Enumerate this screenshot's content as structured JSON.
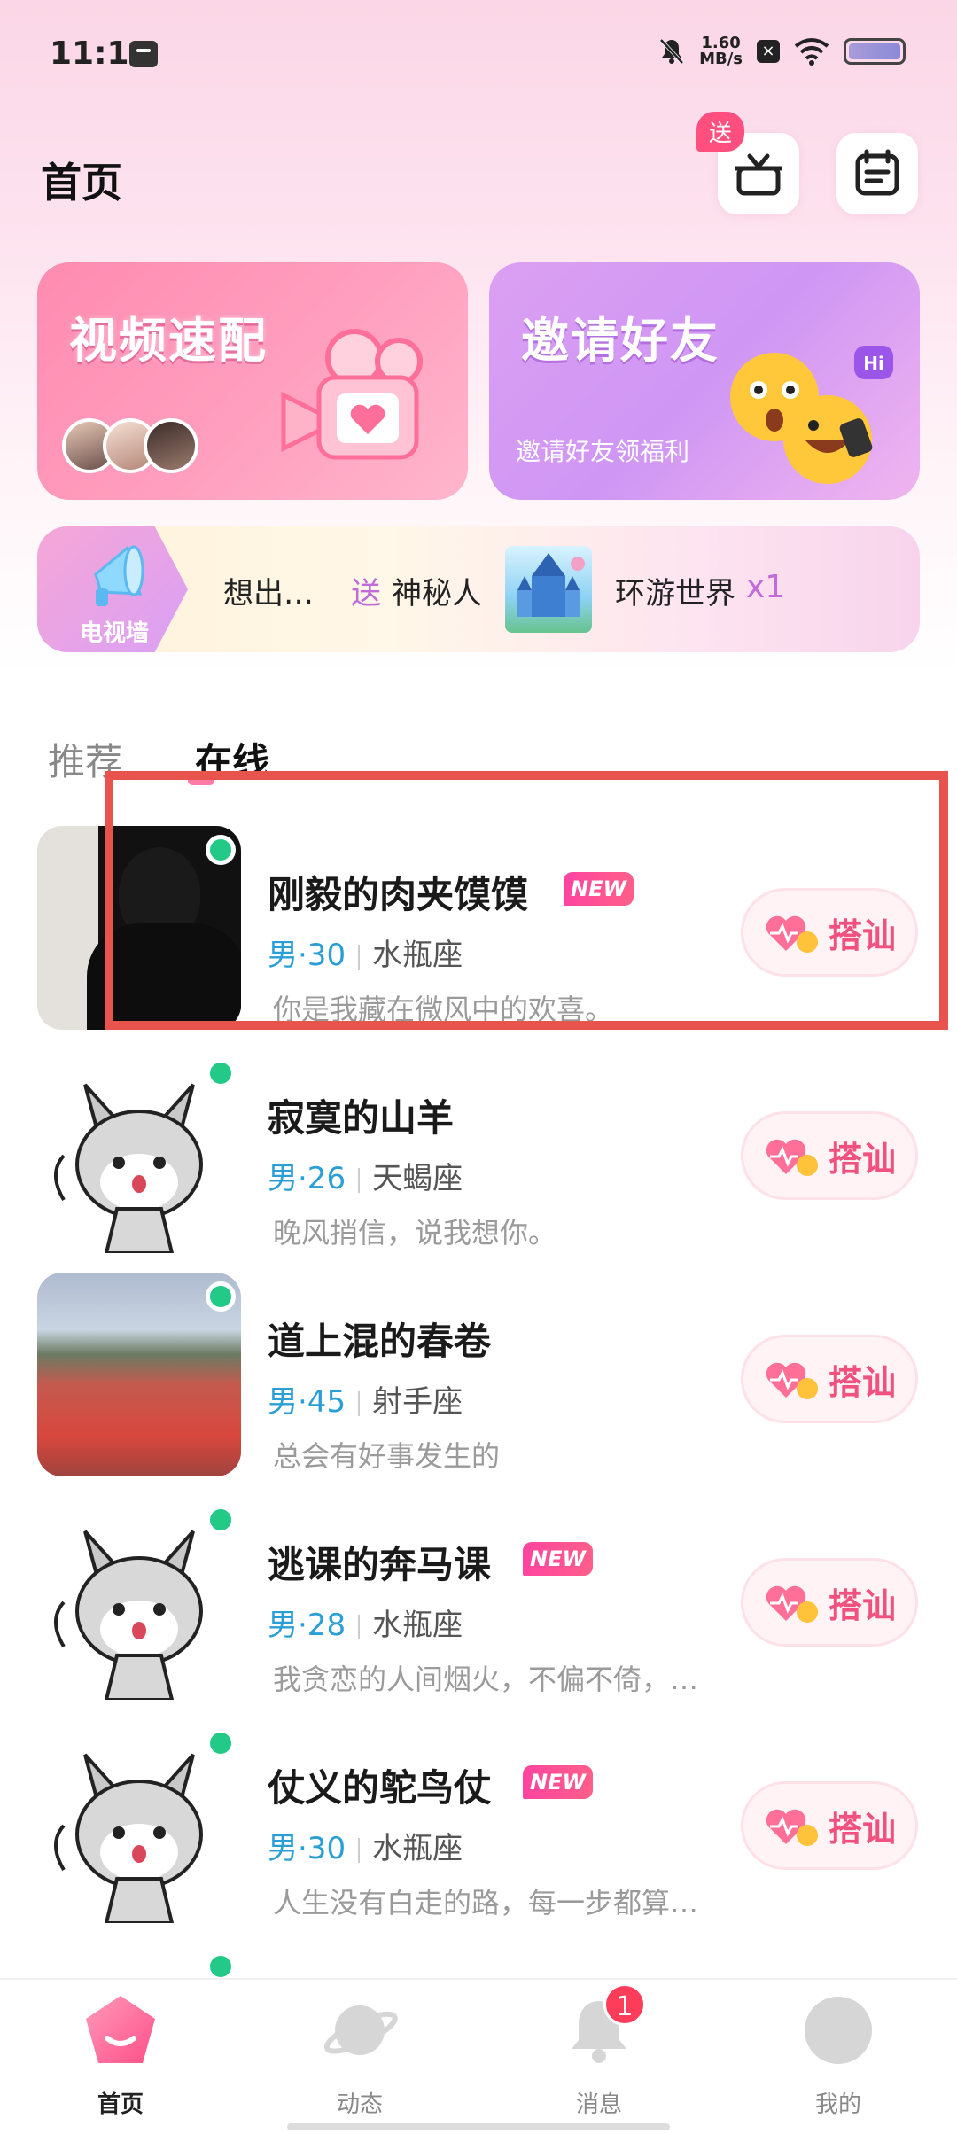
{
  "status_bar": {
    "time": "11:11",
    "net_speed_value": "1.60",
    "net_speed_unit": "MB/s"
  },
  "header": {
    "title": "首页",
    "gift_badge": "送"
  },
  "cards": {
    "video": {
      "title": "视频速配"
    },
    "invite": {
      "title": "邀请好友",
      "subtitle": "邀请好友领福利",
      "hi_badge": "Hi"
    }
  },
  "tv_wall": {
    "label": "电视墙",
    "user": "想出…",
    "send_word": "送",
    "target": "神秘人",
    "gift_name": "环游世界",
    "count": "x1"
  },
  "tabs": [
    {
      "label": "推荐",
      "active": false
    },
    {
      "label": "在线",
      "active": true
    }
  ],
  "users": [
    {
      "name": "刚毅的肉夹馍馍",
      "is_new": true,
      "new_label": "NEW",
      "gender_age": "男·30",
      "zodiac": "水瓶座",
      "bio": "你是我藏在微风中的欢喜。",
      "online": true,
      "avatar": "photo-man",
      "action": "搭讪"
    },
    {
      "name": "寂寞的山羊",
      "is_new": false,
      "new_label": "",
      "gender_age": "男·26",
      "zodiac": "天蝎座",
      "bio": "晚风捎信，说我想你。",
      "online": true,
      "avatar": "cat",
      "action": "搭讪"
    },
    {
      "name": "道上混的春卷",
      "is_new": false,
      "new_label": "",
      "gender_age": "男·45",
      "zodiac": "射手座",
      "bio": "总会有好事发生的",
      "online": true,
      "avatar": "photo-field",
      "action": "搭讪"
    },
    {
      "name": "逃课的奔马课",
      "is_new": true,
      "new_label": "NEW",
      "gender_age": "男·28",
      "zodiac": "水瓶座",
      "bio": "我贪恋的人间烟火，不偏不倚，…",
      "online": true,
      "avatar": "cat",
      "action": "搭讪"
    },
    {
      "name": "仗义的鸵鸟仗",
      "is_new": true,
      "new_label": "NEW",
      "gender_age": "男·30",
      "zodiac": "水瓶座",
      "bio": "人生没有白走的路，每一步都算…",
      "online": true,
      "avatar": "cat",
      "action": "搭讪"
    }
  ],
  "bottom_nav": [
    {
      "label": "首页",
      "active": true
    },
    {
      "label": "动态",
      "active": false
    },
    {
      "label": "消息",
      "active": false,
      "badge": "1"
    },
    {
      "label": "我的",
      "active": false
    }
  ],
  "colors": {
    "accent_pink": "#f0517f",
    "online_green": "#22c987",
    "gender_blue": "#2a9fd6",
    "highlight_red": "#e8534e"
  }
}
